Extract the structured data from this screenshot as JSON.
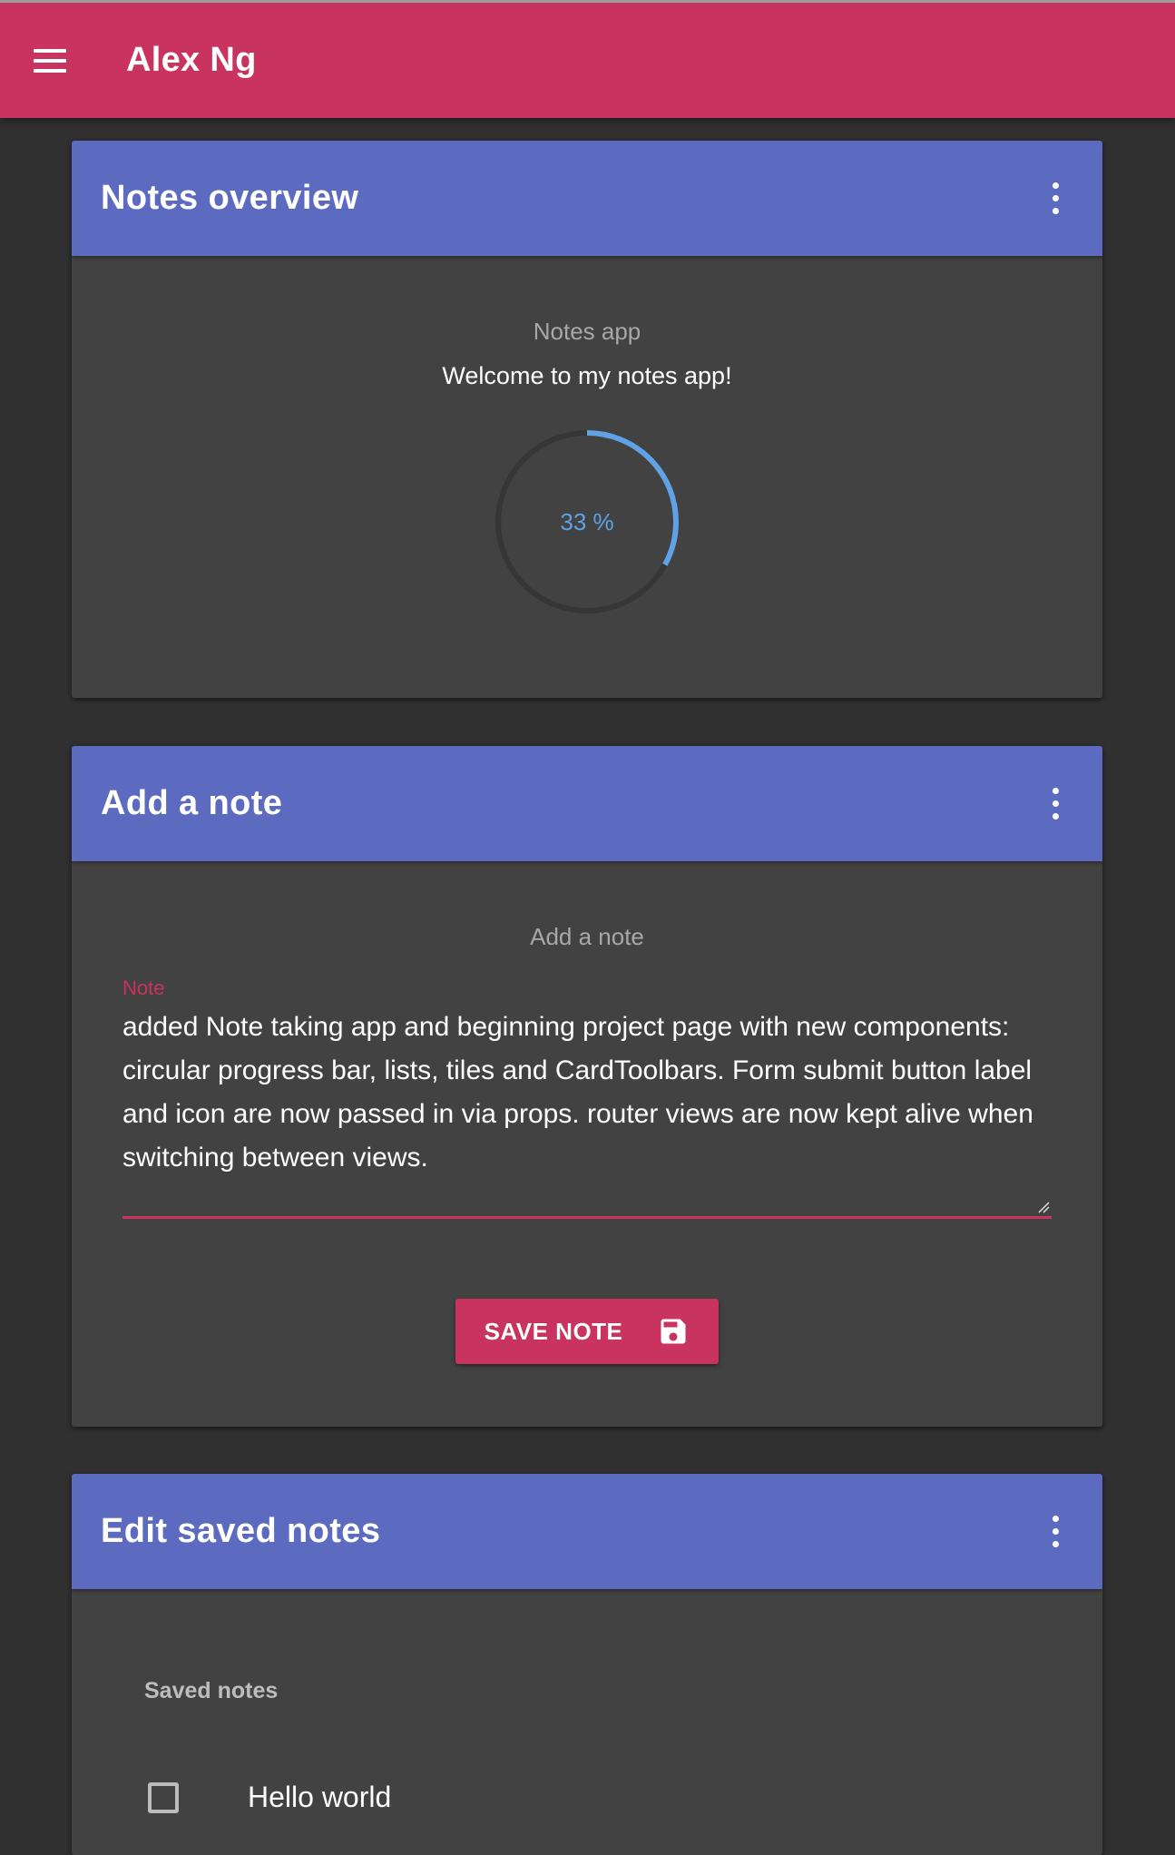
{
  "app_bar": {
    "title": "Alex Ng",
    "menu_icon": "menu-icon",
    "color": "#c9335f"
  },
  "overview": {
    "title": "Notes overview",
    "caption": "Notes app",
    "welcome": "Welcome to my notes app!",
    "progress_percent": 33,
    "progress_label": "33 %",
    "progress_color": "#5fa3e6",
    "more_icon": "more-vert-icon"
  },
  "add_note": {
    "title": "Add a note",
    "caption": "Add a note",
    "field_label": "Note",
    "field_value": "added Note taking app and beginning project page with new components: circular progress bar, lists, tiles and CardToolbars. Form submit button label and icon are now passed in via props. router views are now kept alive when switching between views.",
    "save_label": "SAVE NOTE",
    "save_icon": "save-icon",
    "more_icon": "more-vert-icon"
  },
  "edit_notes": {
    "title": "Edit saved notes",
    "subheader": "Saved notes",
    "items": [
      {
        "title": "Hello world"
      }
    ],
    "more_icon": "more-vert-icon"
  },
  "colors": {
    "primary": "#c9335f",
    "toolbar": "#5c6bc0",
    "card": "#424242",
    "background": "#303030"
  }
}
